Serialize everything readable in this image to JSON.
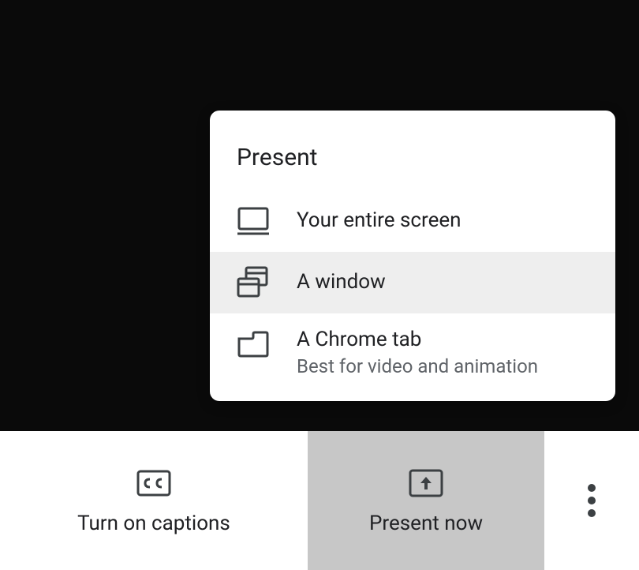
{
  "presentMenu": {
    "title": "Present",
    "items": [
      {
        "label": "Your entire screen",
        "sublabel": null
      },
      {
        "label": "A window",
        "sublabel": null
      },
      {
        "label": "A Chrome tab",
        "sublabel": "Best for video and animation"
      }
    ]
  },
  "toolbar": {
    "captions_label": "Turn on captions",
    "present_label": "Present now"
  }
}
